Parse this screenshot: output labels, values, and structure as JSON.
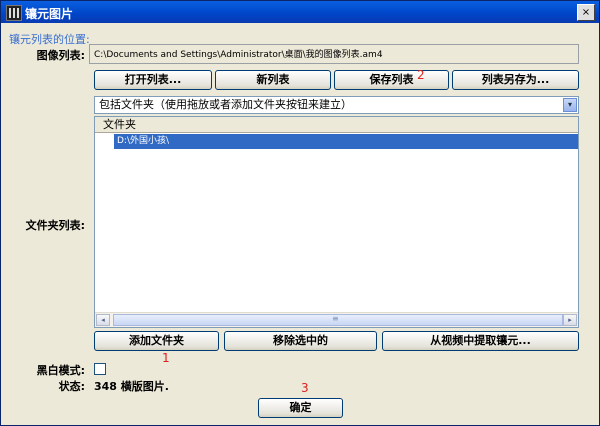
{
  "window": {
    "title": "镶元图片",
    "close": "×"
  },
  "section_title": "镶元列表的位置:",
  "image_list": {
    "label": "图像列表:",
    "path": "C:\\Documents and Settings\\Administrator\\桌面\\我的图像列表.am4"
  },
  "buttons_row1": [
    "打开列表...",
    "新列表",
    "保存列表",
    "列表另存为..."
  ],
  "annotations": {
    "n1": "1",
    "n2": "2",
    "n3": "3"
  },
  "combo": {
    "value": "包括文件夹（使用拖放或者添加文件夹按钮来建立）",
    "arrow": "▾"
  },
  "folder_list": {
    "label": "文件夹列表:",
    "column": "文件夹",
    "items": [
      "D:\\外国小孩\\"
    ],
    "scroll_left": "◂",
    "scroll_right": "▸",
    "thumb_grip": "≡"
  },
  "buttons_row2": [
    "添加文件夹",
    "移除选中的",
    "从视频中提取镶元..."
  ],
  "bw_mode": {
    "label": "黑白模式:",
    "checked": false
  },
  "status": {
    "label": "状态:",
    "value": "348 横版图片."
  },
  "ok_button": "确定"
}
